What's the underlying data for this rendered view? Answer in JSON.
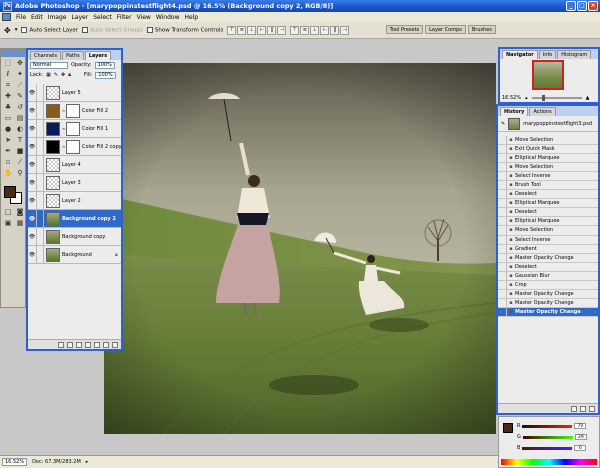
{
  "window": {
    "title": "Adobe Photoshop - [marypoppinstestflight4.psd @ 16.5% (Background copy 2, RGB/8)]",
    "logo": "Ps"
  },
  "menu": [
    "File",
    "Edit",
    "Image",
    "Layer",
    "Select",
    "Filter",
    "View",
    "Window",
    "Help"
  ],
  "options": {
    "auto_select_layer": "Auto Select Layer",
    "auto_select_groups": "Auto Select Groups",
    "show_transform_controls": "Show Transform Controls",
    "wells": [
      "Tool Presets",
      "Layer Comps",
      "Brushes"
    ]
  },
  "layers_panel": {
    "tabs": [
      "Channels",
      "Paths",
      "Layers"
    ],
    "blend_mode": "Normal",
    "opacity_label": "Opacity:",
    "opacity": "100%",
    "lock_label": "Lock:",
    "fill_label": "Fill:",
    "fill": "100%",
    "layers": [
      {
        "name": "Layer 5",
        "thumb": "transparent",
        "mask": false,
        "selected": false,
        "lock": false
      },
      {
        "name": "Color Fill 2",
        "thumb": "#8a5a18",
        "mask": true,
        "selected": false,
        "lock": false
      },
      {
        "name": "Color Fill 1",
        "thumb": "#0a1b5c",
        "mask": true,
        "selected": false,
        "lock": false
      },
      {
        "name": "Color Fill 2 copy",
        "thumb": "#000000",
        "mask": true,
        "selected": false,
        "lock": false
      },
      {
        "name": "Layer 4",
        "thumb": "transparent",
        "mask": false,
        "selected": false,
        "lock": false
      },
      {
        "name": "Layer 3",
        "thumb": "transparent",
        "mask": false,
        "selected": false,
        "lock": false
      },
      {
        "name": "Layer 2",
        "thumb": "transparent",
        "mask": false,
        "selected": false,
        "lock": false
      },
      {
        "name": "Background copy 2",
        "thumb": "photo",
        "mask": false,
        "selected": true,
        "lock": false
      },
      {
        "name": "Background copy",
        "thumb": "photo",
        "mask": false,
        "selected": false,
        "lock": false
      },
      {
        "name": "Background",
        "thumb": "photo",
        "mask": false,
        "selected": false,
        "lock": true
      }
    ]
  },
  "navigator": {
    "tabs": [
      "Navigator",
      "Info",
      "Histogram"
    ],
    "zoom": "16.52%"
  },
  "history": {
    "tabs": [
      "History",
      "Actions"
    ],
    "snapshot": "marypoppinstestflight3.psd",
    "items": [
      "Move Selection",
      "Exit Quick Mask",
      "Elliptical Marquee",
      "Move Selection",
      "Select Inverse",
      "Brush Tool",
      "Deselect",
      "Elliptical Marquee",
      "Deselect",
      "Elliptical Marquee",
      "Move Selection",
      "Select Inverse",
      "Gradient",
      "Master Opacity Change",
      "Deselect",
      "Gaussian Blur",
      "Crop",
      "Master Opacity Change",
      "Master Opacity Change",
      "Master Opacity Change"
    ],
    "selected_index": 19
  },
  "color_panel": {
    "r": "70",
    "g": "29",
    "b": "6"
  },
  "status": {
    "zoom": "16.52%",
    "doc": "Doc: 67.3M/283.2M"
  },
  "colors": {
    "titlebar": "#1a54c8",
    "panel_border": "#2f5fd0",
    "selection": "#3169c6",
    "foreground": "#4a2a15"
  }
}
